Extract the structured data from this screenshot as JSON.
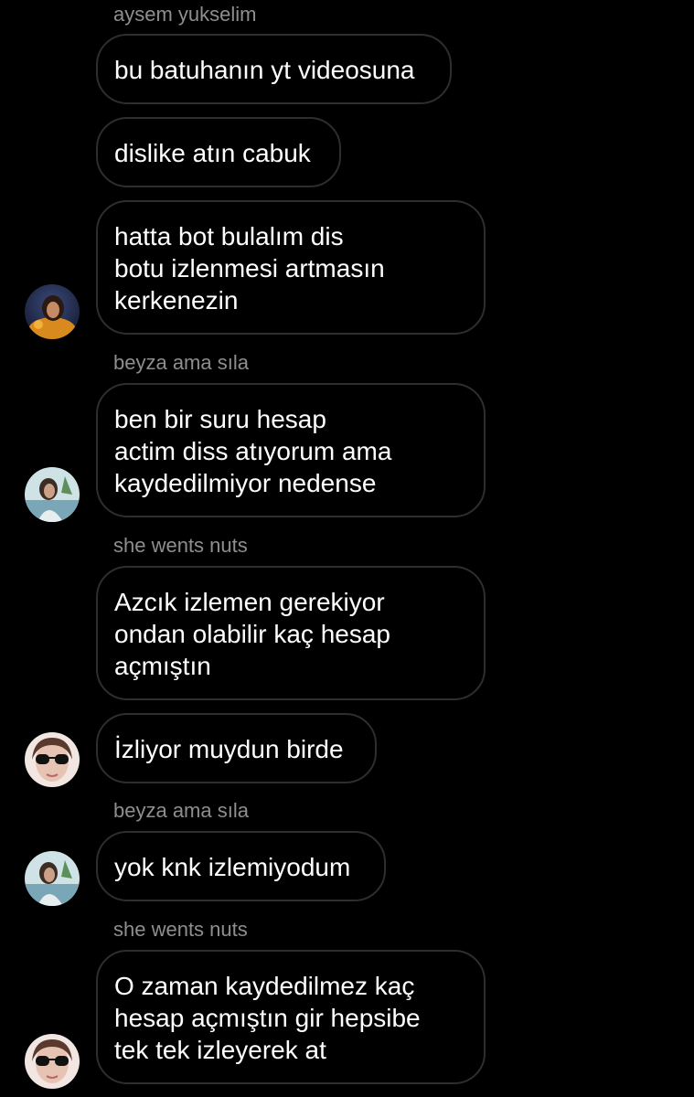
{
  "colors": {
    "background": "#000000",
    "bubble_border": "#2e2e2e",
    "message_text": "#ffffff",
    "sender_text": "#8e8e8e"
  },
  "senders": {
    "s1": "aysem yukselim",
    "s2": "beyza ama sıla",
    "s3": "she wents nuts",
    "s4": "beyza ama sıla",
    "s5": "she wents nuts"
  },
  "messages": {
    "m1": "bu batuhanın yt videosuna",
    "m2": "dislike atın cabuk",
    "m3": "hatta bot bulalım dis\nbotu izlenmesi artmasın\nkerkenezin",
    "m4": "ben bir suru hesap\nactim diss atıyorum ama\nkaydedilmiyor nedense",
    "m5": "Azcık izlemen gerekiyor\nondan olabilir kaç hesap\naçmıştın",
    "m6": "İzliyor muydun birde",
    "m7": "yok knk izlemiyodum",
    "m8": "O zaman kaydedilmez kaç\nhesap açmıştın gir hepsibe\ntek tek izleyerek at"
  }
}
